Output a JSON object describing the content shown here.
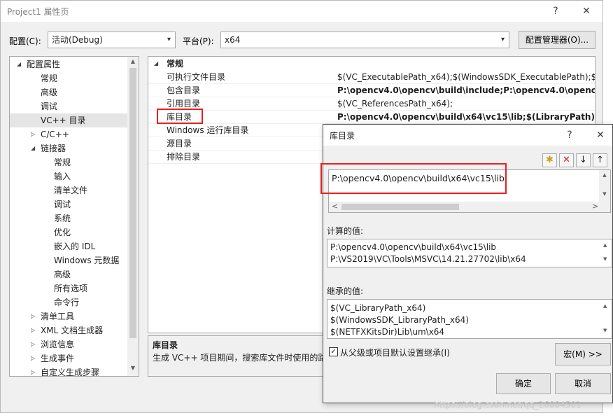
{
  "window": {
    "title": "Project1 属性页",
    "help": "?",
    "close": "✕"
  },
  "toolbar": {
    "config_label": "配置(C):",
    "config_value": "活动(Debug)",
    "platform_label": "平台(P):",
    "platform_value": "x64",
    "config_manager_label": "配置管理器(O)..."
  },
  "tree": {
    "items": [
      {
        "label": "配置属性",
        "toggle": "◢"
      },
      {
        "label": "常规"
      },
      {
        "label": "高级"
      },
      {
        "label": "调试"
      },
      {
        "label": "VC++ 目录"
      },
      {
        "label": "C/C++",
        "toggle": "▷"
      },
      {
        "label": "链接器",
        "toggle": "◢"
      },
      {
        "label": "常规"
      },
      {
        "label": "输入"
      },
      {
        "label": "清单文件"
      },
      {
        "label": "调试"
      },
      {
        "label": "系统"
      },
      {
        "label": "优化"
      },
      {
        "label": "嵌入的 IDL"
      },
      {
        "label": "Windows 元数据"
      },
      {
        "label": "高级"
      },
      {
        "label": "所有选项"
      },
      {
        "label": "命令行"
      },
      {
        "label": "清单工具",
        "toggle": "▷"
      },
      {
        "label": "XML 文档生成器",
        "toggle": "▷"
      },
      {
        "label": "浏览信息",
        "toggle": "▷"
      },
      {
        "label": "生成事件",
        "toggle": "▷"
      },
      {
        "label": "自定义生成步骤",
        "toggle": "▷"
      }
    ]
  },
  "grid": {
    "section_toggle": "◢",
    "section": "常规",
    "rows": [
      {
        "name": "可执行文件目录",
        "value": "$(VC_ExecutablePath_x64);$(WindowsSDK_ExecutablePath);$(VS_"
      },
      {
        "name": "包含目录",
        "value": "P:\\opencv4.0\\opencv\\build\\include;P:\\opencv4.0\\opencv\\bu"
      },
      {
        "name": "引用目录",
        "value": "$(VC_ReferencesPath_x64);"
      },
      {
        "name": "库目录",
        "value": "P:\\opencv4.0\\opencv\\build\\x64\\vc15\\lib;$(LibraryPath)"
      },
      {
        "name": "Windows 运行库目录",
        "value": ""
      },
      {
        "name": "源目录",
        "value": ""
      },
      {
        "name": "排除目录",
        "value": ""
      }
    ]
  },
  "description": {
    "title": "库目录",
    "text": "生成 VC++ 项目期间，搜索库文件时使用的路"
  },
  "dialog": {
    "title": "库目录",
    "help": "?",
    "close": "✕",
    "tools": {
      "new_folder": "✱",
      "delete": "✕",
      "move_down": "↓",
      "move_up": "↑"
    },
    "entry": "P:\\opencv4.0\\opencv\\build\\x64\\vc15\\lib",
    "computed_label": "计算的值:",
    "computed": [
      "P:\\opencv4.0\\opencv\\build\\x64\\vc15\\lib",
      "P:\\VS2019\\VC\\Tools\\MSVC\\14.21.27702\\lib\\x64"
    ],
    "inherited_label": "继承的值:",
    "inherited": [
      "$(VC_LibraryPath_x64)",
      "$(WindowsSDK_LibraryPath_x64)",
      "$(NETFXKitsDir)Lib\\um\\x64"
    ],
    "inherit_checkbox_label": "从父级或项目默认设置继承(I)",
    "inherit_checked": true,
    "macro_button": "宏(M) >>",
    "ok_button": "确定",
    "cancel_button": "取消"
  },
  "watermark": "https://blog.csdn.net/qq_26884501",
  "scroll_glyphs": {
    "up": "▲",
    "down": "▼",
    "left": "<",
    "right": ">",
    "combo": "▾"
  },
  "colors": {
    "highlight_red": "#e82020",
    "selection_bg": "#e5e5e5",
    "window_bg": "#f0f0f0"
  }
}
